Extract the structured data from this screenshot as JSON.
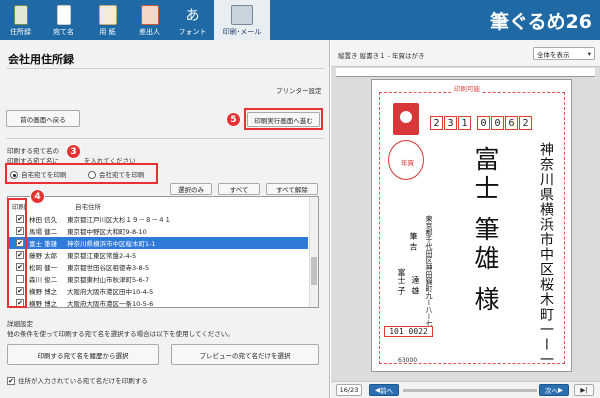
{
  "toolbar": {
    "items": [
      {
        "label": "住所録",
        "icon": "address-book-icon"
      },
      {
        "label": "宛て名",
        "icon": "address-name-icon"
      },
      {
        "label": "用 紙",
        "icon": "paper-icon"
      },
      {
        "label": "差出人",
        "icon": "sender-icon"
      },
      {
        "label": "フォント",
        "icon": "font-icon",
        "glyph": "あ"
      },
      {
        "label": "印刷･メール",
        "icon": "print-mail-icon"
      }
    ],
    "brand": "筆ぐるめ26",
    "colors": {
      "bar": "#1f6aa5",
      "accent": "#e53232",
      "selected": "#2f7ad9"
    }
  },
  "panel": {
    "title": "会社用住所録",
    "printer_settings": "プリンター設定",
    "back_button": "前の画面へ戻る",
    "print_exec_button": "印刷実行画面へ進む",
    "section_label": "印刷する宛て名の",
    "section_hint": "印刷する宛て名に",
    "section_hint_tail": "を入れてください",
    "radio_home": "自宅宛てを印刷",
    "radio_company": "会社宛てを印刷",
    "btn_selected_only": "選択のみ",
    "btn_all": "すべて",
    "btn_clear_all": "すべて解除",
    "col_print": "印刷",
    "col_address": "自宅住所",
    "rows": [
      {
        "name": "林田 信久",
        "addr": "東京都江戸川区大杉１９－８－４１",
        "checked": "✔"
      },
      {
        "name": "馬場 健二",
        "addr": "東京都中野区大和町9-8-10",
        "checked": "✔"
      },
      {
        "name": "富士 筆雄",
        "addr": "神奈川県横浜市中区桜木町1-1",
        "checked": "✔"
      },
      {
        "name": "藤野 太郎",
        "addr": "東京都江東区常盤2-4-5",
        "checked": "✔"
      },
      {
        "name": "松岡 健一",
        "addr": "東京都世田谷区祖徳寺3-8-5",
        "checked": "✔"
      },
      {
        "name": "森川 俊二",
        "addr": "東京都東村山市秋津町5-6-7",
        "checked": ""
      },
      {
        "name": "横野 博之",
        "addr": "大阪府大阪市港区田中10-4-5",
        "checked": "✔"
      },
      {
        "name": "横野 博之",
        "addr": "大阪府大阪市港区一条10-5-6",
        "checked": "✔"
      }
    ],
    "detail_title": "詳細設定",
    "detail_desc": "他の条件を使って印刷する宛て名を選択する場合は以下を使用してください。",
    "btn_history": "印刷する宛て名を履歴から選択",
    "btn_preview_only": "プレビューの宛て名だけを選択",
    "chk_address_only": "住所が入力されている宛て名だけを印刷する",
    "badges": {
      "b3": "3",
      "b4": "4",
      "b5": "5"
    }
  },
  "preview": {
    "header": "縦置き 縦書き１ - 年賀はがき",
    "zoom": "全体を表示",
    "card_label": "印刷可能",
    "zip_to": [
      "2",
      "3",
      "1",
      "0",
      "0",
      "6",
      "2"
    ],
    "address_to_1": "神奈川県横浜市中区桜木町一ー一",
    "name_to": "富士 筆雄 様",
    "sender_addr": "東京都千代田区神田錦町九ー八ー七",
    "sender_name_1": "筆 吉",
    "sender_name_2": "達 雄",
    "sender_name_3": "富士 子",
    "zip_from": "101 0022",
    "stamp_label": "年賀",
    "price": "63000",
    "page": "16/23",
    "prev": "前へ",
    "next": "次へ"
  }
}
